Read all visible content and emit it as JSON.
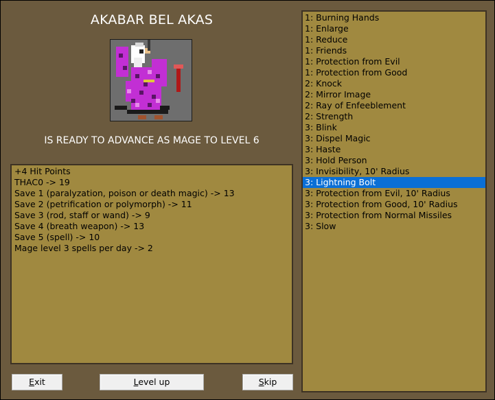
{
  "dialog": {
    "character_name": "AKABAR BEL AKAS",
    "advance_message": "IS READY TO ADVANCE AS MAGE TO LEVEL 6"
  },
  "stat_changes": [
    "+4 Hit Points",
    "THAC0 -> 19",
    "Save 1 (paralyzation, poison or death magic) -> 13",
    "Save 2 (petrification or polymorph) -> 11",
    "Save 3 (rod, staff or wand) -> 9",
    "Save 4 (breath weapon) -> 13",
    "Save 5 (spell) -> 10",
    "Mage level 3 spells per day -> 2"
  ],
  "spells": {
    "selected_index": 15,
    "items": [
      "1: Burning Hands",
      "1: Enlarge",
      "1: Reduce",
      "1: Friends",
      "1: Protection from Evil",
      "1: Protection from Good",
      "2: Knock",
      "2: Mirror Image",
      "2: Ray of Enfeeblement",
      "2: Strength",
      "3: Blink",
      "3: Dispel Magic",
      "3: Haste",
      "3: Hold Person",
      "3: Invisibility, 10' Radius",
      "3: Lightning Bolt",
      "3: Protection from Evil, 10' Radius",
      "3: Protection from Good, 10' Radius",
      "3: Protection from Normal Missiles",
      "3: Slow"
    ]
  },
  "buttons": {
    "exit": {
      "accel": "E",
      "rest": "xit"
    },
    "level_up": {
      "accel": "L",
      "rest": "evel up"
    },
    "skip": {
      "accel": "S",
      "rest": "kip"
    }
  },
  "colors": {
    "window_bg": "#6b5a3e",
    "panel_bg": "#a08940",
    "selection": "#0a6fd6"
  }
}
